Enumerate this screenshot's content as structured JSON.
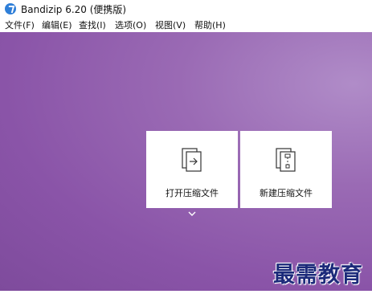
{
  "window": {
    "title": "Bandizip 6.20 (便携版)",
    "icon": "bandizip-logo-icon"
  },
  "menubar": {
    "items": [
      {
        "label": "文件(F)"
      },
      {
        "label": "编辑(E)"
      },
      {
        "label": "查找(I)"
      },
      {
        "label": "选项(O)"
      },
      {
        "label": "视图(V)"
      },
      {
        "label": "帮助(H)"
      }
    ]
  },
  "main": {
    "cards": [
      {
        "label": "打开压缩文件",
        "icon": "open-archive-icon"
      },
      {
        "label": "新建压缩文件",
        "icon": "new-archive-icon"
      }
    ],
    "expand_icon": "chevron-down-icon"
  },
  "watermark": {
    "text": "最需教育"
  },
  "colors": {
    "background": "#8a54a8",
    "card": "#ffffff",
    "accent_icon": "#2f7fd8",
    "watermark": "#1c2a7a"
  }
}
